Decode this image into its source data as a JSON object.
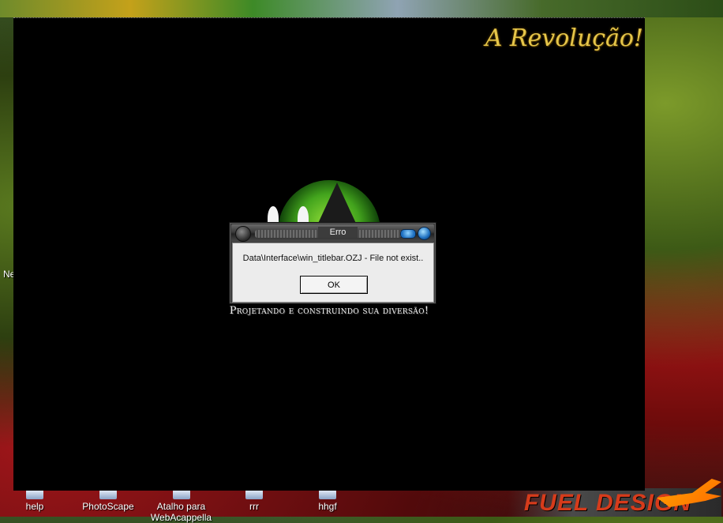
{
  "desktop": {
    "icons": [
      {
        "label": "help"
      },
      {
        "label": "PhotoScape"
      },
      {
        "label": "Atalho para WebAcappella"
      },
      {
        "label": "rrr"
      },
      {
        "label": "hhgf"
      }
    ],
    "left_fragment": "Ne",
    "wallpaper_text": "FUEL DESIGN"
  },
  "game": {
    "brand": "A Revolução!",
    "tagline": "Projetando e construindo sua diversão!"
  },
  "dialog": {
    "title": "Erro",
    "message": "Data\\Interface\\win_titlebar.OZJ - File not exist..",
    "ok_label": "OK"
  },
  "colors": {
    "game_background": "#000000",
    "dialog_panel": "#ececec",
    "brand_gold": "#e6c64a",
    "window_button_blue": "#1d6fc0"
  }
}
